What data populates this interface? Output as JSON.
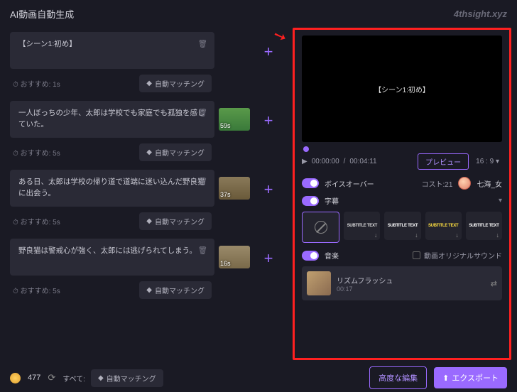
{
  "header": {
    "title": "AI動画自動生成",
    "watermark": "4thsight.xyz"
  },
  "scenes": [
    {
      "text": "【シーン1:初め】",
      "recommend": "おすすめ: 1s",
      "automatch": "自動マッチング",
      "thumb": null,
      "thumb_bg": ""
    },
    {
      "text": "一人ぼっちの少年、太郎は学校でも家庭でも孤独を感じていた。",
      "recommend": "おすすめ: 5s",
      "automatch": "自動マッチング",
      "thumb": "59s",
      "thumb_bg": "linear-gradient(#5a9a4a,#3a7a3a)"
    },
    {
      "text": "ある日、太郎は学校の帰り道で道端に迷い込んだ野良猫に出会う。",
      "recommend": "おすすめ: 5s",
      "automatch": "自動マッチング",
      "thumb": "37s",
      "thumb_bg": "linear-gradient(#8a7a5a,#6a5a3a)"
    },
    {
      "text": "野良猫は警戒心が強く、太郎には逃げられてしまう。",
      "recommend": "おすすめ: 5s",
      "automatch": "自動マッチング",
      "thumb": "16s",
      "thumb_bg": "linear-gradient(#9a8a6a,#7a6a4a)"
    }
  ],
  "preview": {
    "scene_label": "【シーン1:初め】",
    "current_time": "00:00:00",
    "total_time": "00:04:11",
    "preview_btn": "プレビュー",
    "ratio": "16 : 9"
  },
  "voiceover": {
    "label": "ボイスオーバー",
    "cost_label": "コスト:21",
    "name": "七海_女"
  },
  "subtitle": {
    "label": "字幕",
    "styles": [
      {
        "label": "",
        "sel": true
      },
      {
        "label": "SUBTITLE TEXT",
        "color": "#ddd"
      },
      {
        "label": "SUBTITLE TEXT",
        "color": "#fff"
      },
      {
        "label": "SUBTITLE TEXT",
        "color": "#ffe040"
      },
      {
        "label": "SUBTITLE TEXT",
        "color": "#fff"
      }
    ]
  },
  "music": {
    "label": "音楽",
    "orig_sound": "動画オリジナルサウンド",
    "track_name": "リズムフラッシュ",
    "track_dur": "00:17"
  },
  "footer": {
    "credits": "477",
    "all_label": "すべて:",
    "automatch": "自動マッチング",
    "adv_edit": "高度な編集",
    "export": "エクスポート"
  }
}
